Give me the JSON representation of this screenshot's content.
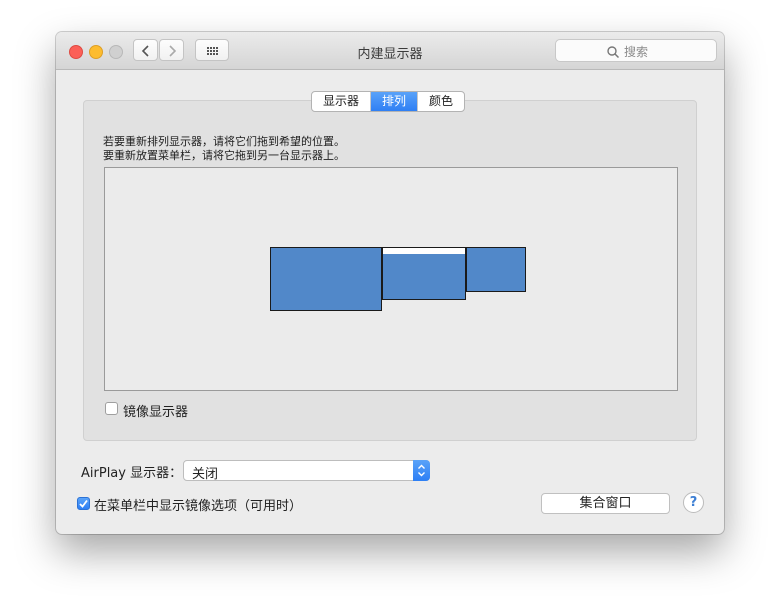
{
  "window": {
    "title": "内建显示器",
    "search_placeholder": "搜索"
  },
  "tabs": [
    {
      "label": "显示器",
      "active": false
    },
    {
      "label": "排列",
      "active": true
    },
    {
      "label": "颜色",
      "active": false
    }
  ],
  "instructions": {
    "line1": "若要重新排列显示器，请将它们拖到希望的位置。",
    "line2": "要重新放置菜单栏，请将它拖到另一台显示器上。"
  },
  "mirror_displays": {
    "label": "镜像显示器",
    "checked": false
  },
  "airplay": {
    "label": "AirPlay 显示器：",
    "value": "关闭"
  },
  "menu_bar_option": {
    "label": "在菜单栏中显示镜像选项（可用时）",
    "checked": true
  },
  "gather_button": {
    "label": "集合窗口"
  },
  "help_button": {
    "label": "?"
  },
  "colors": {
    "accent": "#2f7ff4",
    "display_fill": "#5188c9"
  }
}
